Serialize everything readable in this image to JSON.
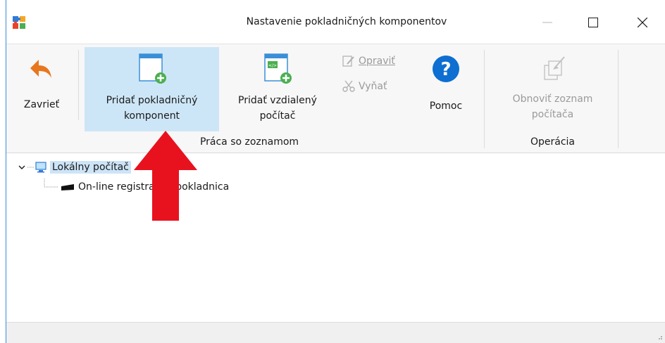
{
  "window": {
    "title": "Nastavenie pokladničných komponentov"
  },
  "ribbon": {
    "close_label": "Zavrieť",
    "add_component_label_line1": "Pridať pokladničný",
    "add_component_label_line2": "komponent",
    "add_remote_label_line1": "Pridať vzdialený",
    "add_remote_label_line2": "počítač",
    "edit_label": "Opraviť",
    "cut_label": "Vyňať",
    "help_label": "Pomoc",
    "refresh_label_line1": "Obnoviť zoznam",
    "refresh_label_line2": "počítača",
    "group_list_label": "Práca so zoznamom",
    "group_operation_label": "Operácia"
  },
  "tree": {
    "root_label": "Lokálny počítač",
    "child_label": "On-line registračná pokladnica"
  },
  "colors": {
    "arrow": "#e8121e",
    "selected": "#cde6f7",
    "accent": "#0c6fd1"
  }
}
